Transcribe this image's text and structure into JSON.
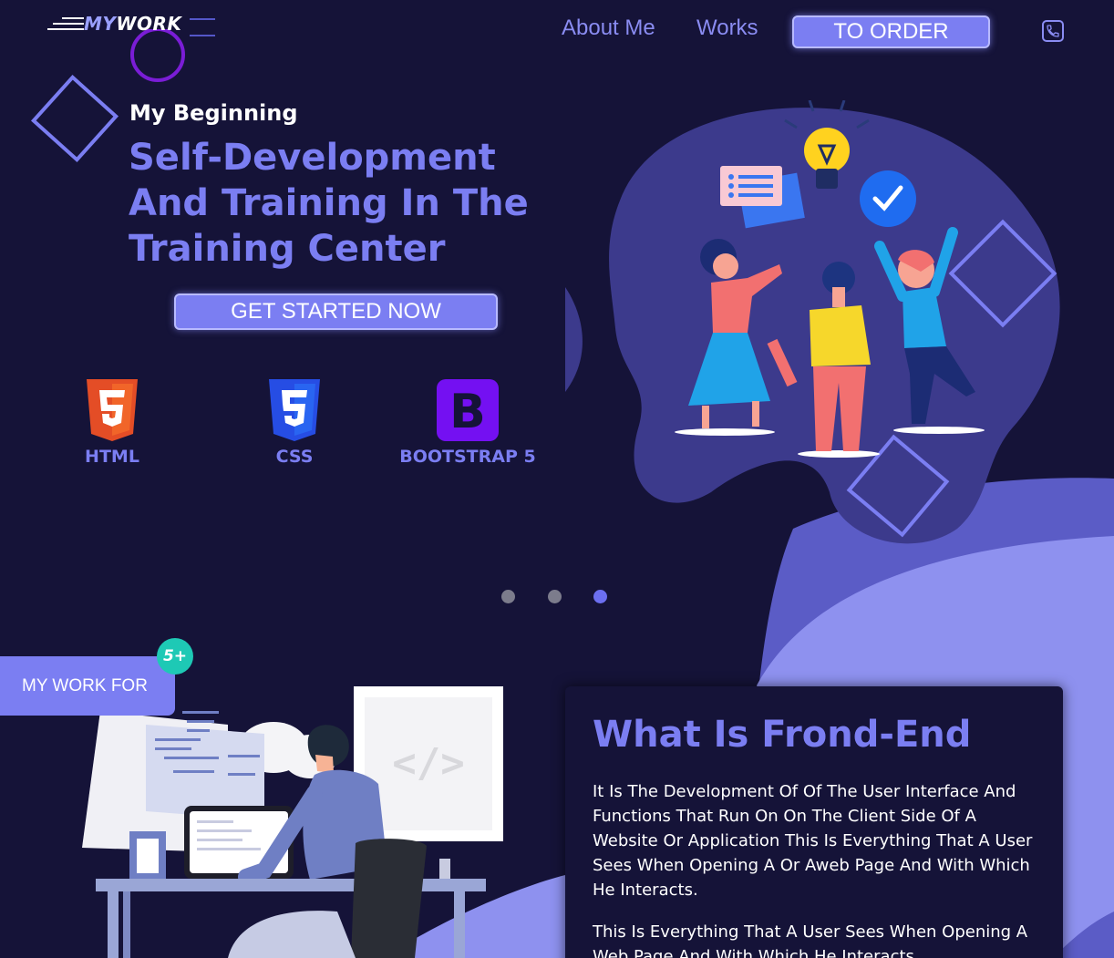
{
  "header": {
    "logo_part1": "MY",
    "logo_part2": "WORK",
    "nav": [
      "About Me",
      "Works"
    ],
    "order_label": "TO ORDER",
    "phone_icon": "phone-icon"
  },
  "hero": {
    "eyebrow": "My Beginning",
    "title": "Self-Development And Training In The Training Center",
    "cta_label": "GET STARTED NOW",
    "tech": [
      {
        "icon": "html5-icon",
        "label": "HTML",
        "color": "#e44d26"
      },
      {
        "icon": "css3-icon",
        "label": "CSS",
        "color": "#264de4"
      },
      {
        "icon": "bootstrap-icon",
        "label": "BOOTSTRAP 5",
        "color": "#7410f2"
      }
    ],
    "illustration": "team-celebrating-illustration"
  },
  "carousel": {
    "slides": 3,
    "active_index": 2
  },
  "work_tab": {
    "label": "MY WORK FOR",
    "badge": "5+"
  },
  "about_card": {
    "title": "What Is Frond-End",
    "p1": "It Is The Development Of Of The User Interface And Functions That Run On On The Client Side Of A Website Or Application This Is Everything That A User Sees When Opening A Or Aweb Page And With Which He Interacts.",
    "p2": "This Is Everything That A User Sees When Opening A Web Page And With Which He Interacts."
  },
  "colors": {
    "background": "#151338",
    "accent": "#7b7ef2",
    "wave": "#8e91ef",
    "badge": "#1ec9b5"
  }
}
